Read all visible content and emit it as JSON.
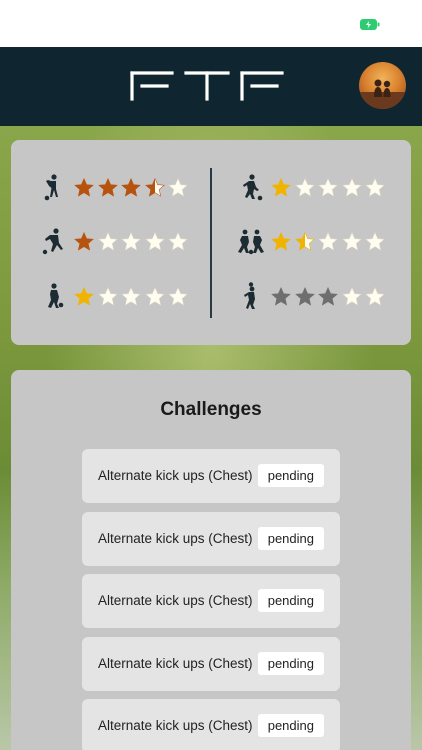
{
  "app": {
    "logo_text": "FTF"
  },
  "status_bar": {
    "battery_icon": "battery-charging-icon",
    "accent_color": "#2ecc71"
  },
  "header": {
    "background_color": "#0f2530",
    "avatar_icon": "avatar-photo"
  },
  "ratings": {
    "left": [
      {
        "skill_icon": "kick-up-player-icon",
        "rating": 3.5,
        "max": 5,
        "color": "#b5530f"
      },
      {
        "skill_icon": "shooting-player-icon",
        "rating": 1,
        "max": 5,
        "color": "#b5530f"
      },
      {
        "skill_icon": "ball-control-player-icon",
        "rating": 1,
        "max": 5,
        "color": "#f0b400"
      }
    ],
    "right": [
      {
        "skill_icon": "dribbling-player-icon",
        "rating": 1,
        "max": 5,
        "color": "#f0b400"
      },
      {
        "skill_icon": "tackle-players-icon",
        "rating": 1.5,
        "max": 5,
        "color": "#f0b400"
      },
      {
        "skill_icon": "header-player-icon",
        "rating": 3,
        "max": 5,
        "color": "#6e6e6e"
      }
    ]
  },
  "challenges": {
    "title": "Challenges",
    "items": [
      {
        "name": "Alternate kick ups (Chest)",
        "status": "pending"
      },
      {
        "name": "Alternate kick ups (Chest)",
        "status": "pending"
      },
      {
        "name": "Alternate kick ups (Chest)",
        "status": "pending"
      },
      {
        "name": "Alternate kick ups (Chest)",
        "status": "pending"
      },
      {
        "name": "Alternate kick ups (Chest)",
        "status": "pending"
      }
    ]
  }
}
